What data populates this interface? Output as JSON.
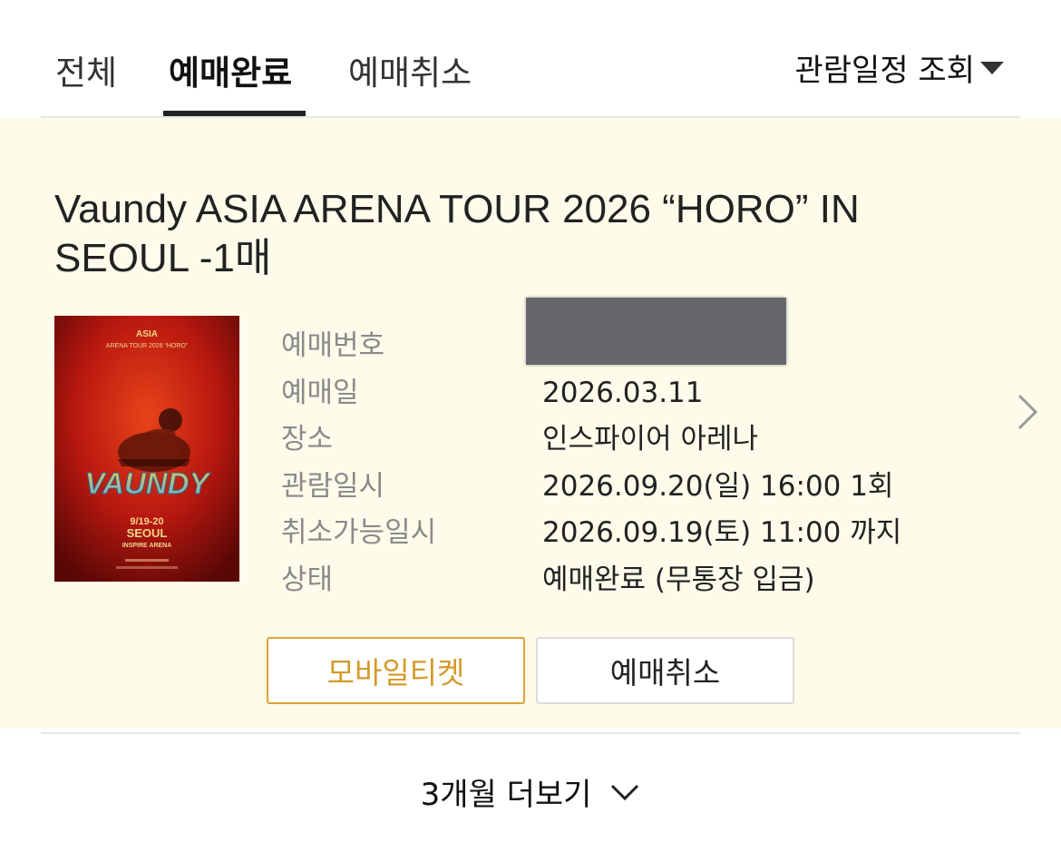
{
  "tabs": [
    {
      "label": "전체",
      "active": false
    },
    {
      "label": "예매완료",
      "active": true
    },
    {
      "label": "예매취소",
      "active": false
    }
  ],
  "filter": {
    "label": "관람일정 조회",
    "icon": "caret-down-icon"
  },
  "booking": {
    "title": "Vaundy ASIA ARENA TOUR 2026 “HORO” IN SEOUL -1매",
    "poster": {
      "line1": "ASIA",
      "line2": "ARENA TOUR 2026 “HORO”",
      "logo": "VAUNDY",
      "date": "9/19-20",
      "city": "SEOUL",
      "venue": "INSPIRE ARENA"
    },
    "fields": [
      {
        "label": "예매번호",
        "value": ""
      },
      {
        "label": "예매일",
        "value": "2026.03.11"
      },
      {
        "label": "장소",
        "value": "인스파이어 아레나"
      },
      {
        "label": "관람일시",
        "value": "2026.09.20(일) 16:00 1회"
      },
      {
        "label": "취소가능일시",
        "value": "2026.09.19(토) 11:00 까지"
      },
      {
        "label": "상태",
        "value": "예매완료 (무통장 입금)"
      }
    ],
    "buttons": {
      "mobile_ticket": "모바일티켓",
      "cancel": "예매취소"
    }
  },
  "more": {
    "label": "3개월 더보기",
    "icon": "chevron-down-icon"
  },
  "colors": {
    "card_background": "#fdfbea",
    "accent": "#d49a2a",
    "redaction": "#66676d"
  }
}
